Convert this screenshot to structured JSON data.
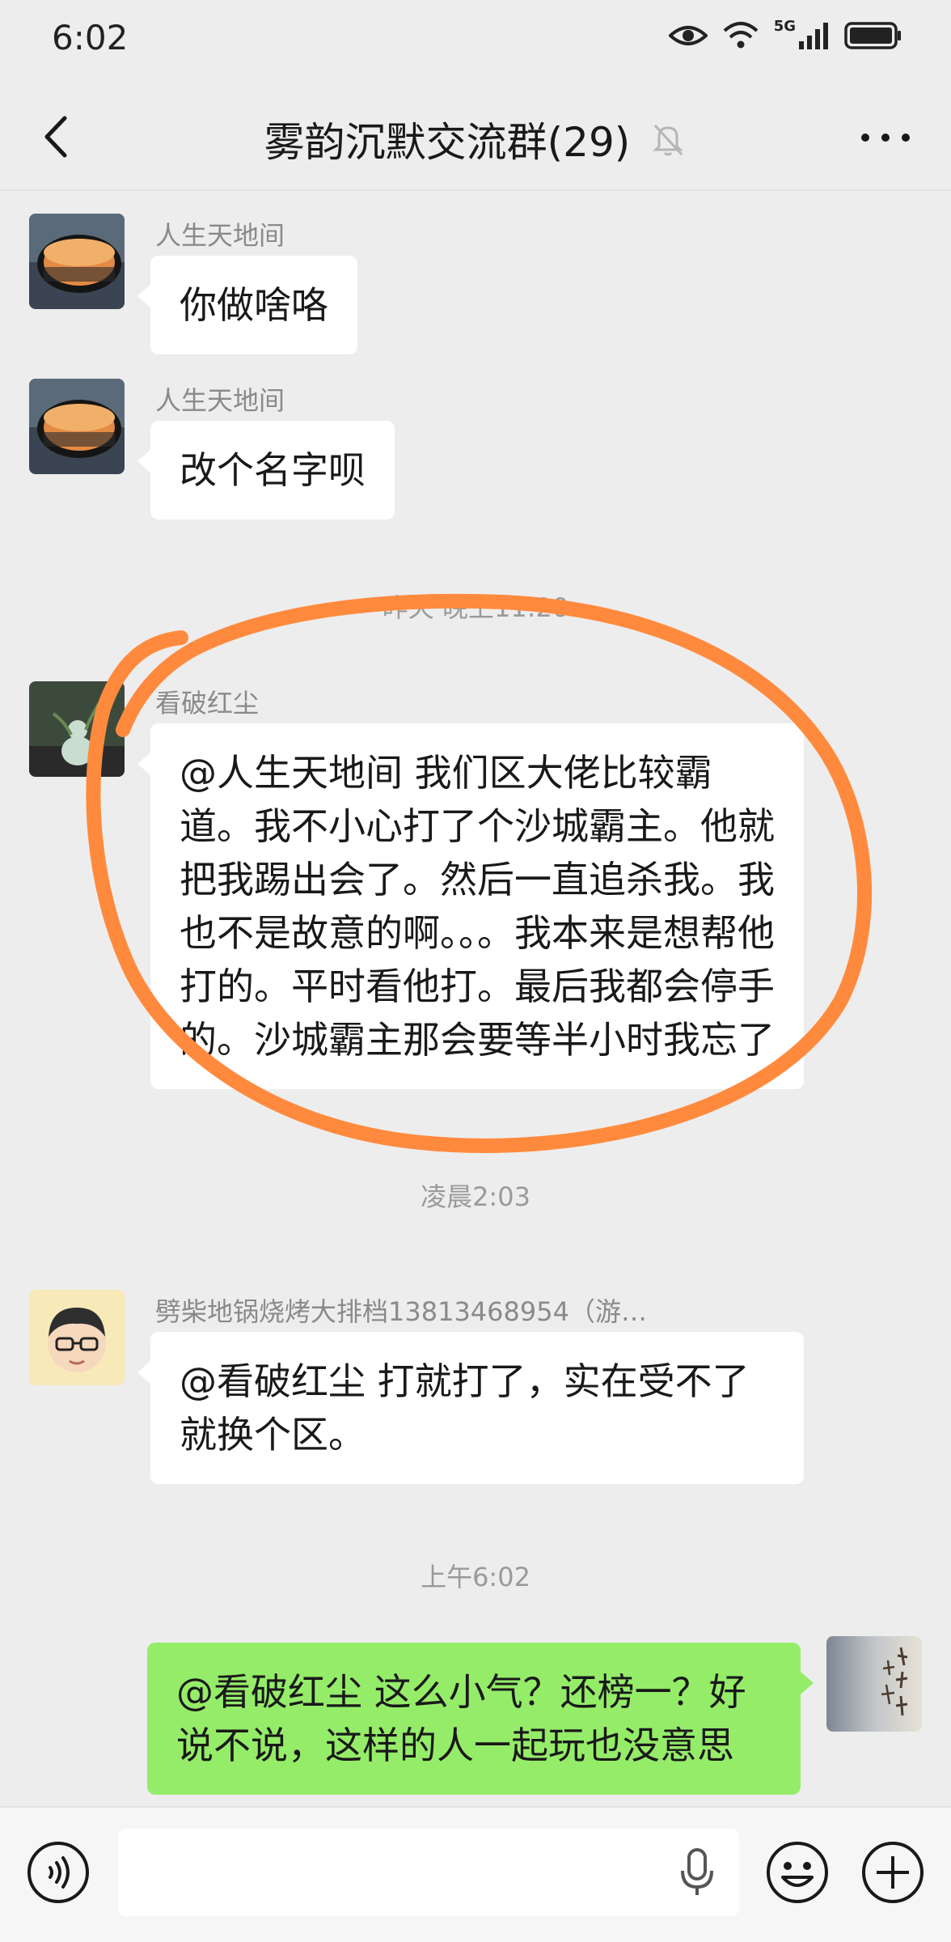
{
  "status_bar": {
    "time": "6:02",
    "network": "5G"
  },
  "nav": {
    "title": "雾韵沉默交流群(29)"
  },
  "messages": [
    {
      "sender": "人生天地间",
      "text": "你做啥咯",
      "side": "left"
    },
    {
      "sender": "人生天地间",
      "text": "改个名字呗",
      "side": "left"
    },
    {
      "sender": "看破红尘",
      "text": "@人生天地间  我们区大佬比较霸道。我不小心打了个沙城霸主。他就把我踢出会了。然后一直追杀我。我也不是故意的啊。。。我本来是想帮他打的。平时看他打。最后我都会停手的。沙城霸主那会要等半小时我忘了",
      "side": "left"
    },
    {
      "sender": "劈柴地锅烧烤大排档13813468954（游…",
      "text": "@看破红尘  打就打了，实在受不了就换个区。",
      "side": "left"
    },
    {
      "sender": "",
      "text": "@看破红尘  这么小气？还榜一？好说不说，这样的人一起玩也没意思",
      "side": "right"
    }
  ],
  "timestamps": [
    "昨天 晚上11:20",
    "凌晨2:03",
    "上午6:02"
  ],
  "colors": {
    "background": "#ededed",
    "bubble_self": "#95ec69",
    "bubble_other": "#ffffff",
    "annotation": "#ff8a3d"
  },
  "icons": [
    "back-icon",
    "mute-bell-icon",
    "more-icon",
    "voice-icon",
    "mic-icon",
    "emoji-icon",
    "plus-icon"
  ]
}
